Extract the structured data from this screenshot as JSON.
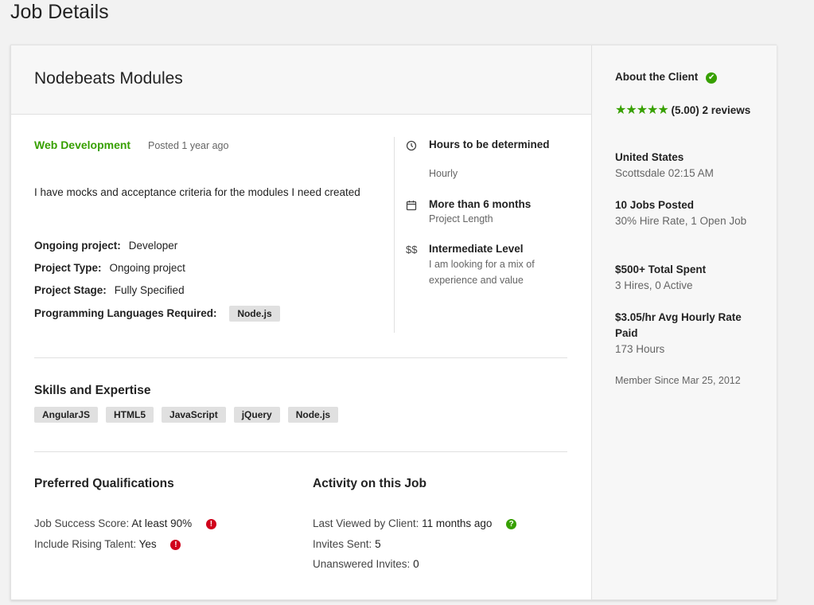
{
  "page": {
    "title": "Job Details"
  },
  "job": {
    "title": "Nodebeats Modules",
    "category": "Web Development",
    "posted": "Posted 1 year ago",
    "description": "I have mocks and acceptance criteria for the modules I need created",
    "details": [
      {
        "label": "Ongoing project:",
        "value": "Developer"
      },
      {
        "label": "Project Type:",
        "value": "Ongoing project"
      },
      {
        "label": "Project Stage:",
        "value": "Fully Specified"
      }
    ],
    "languages_label": "Programming Languages Required:",
    "languages": [
      "Node.js"
    ]
  },
  "summary": [
    {
      "icon": "clock-icon",
      "title": "Hours to be determined",
      "sub": "Hourly"
    },
    {
      "icon": "calendar-icon",
      "title": "More than 6 months",
      "sub": "Project Length"
    },
    {
      "icon": "dollar-icon",
      "symbol": "$$",
      "title": "Intermediate Level",
      "sub": "I am looking for a mix of experience and value"
    }
  ],
  "skills": {
    "heading": "Skills and Expertise",
    "tags": [
      "AngularJS",
      "HTML5",
      "JavaScript",
      "jQuery",
      "Node.js"
    ]
  },
  "qualifications": {
    "heading": "Preferred Qualifications",
    "items": [
      {
        "label": "Job Success Score:",
        "value": "At least 90%"
      },
      {
        "label": "Include Rising Talent:",
        "value": "Yes"
      }
    ]
  },
  "activity": {
    "heading": "Activity on this Job",
    "items": [
      {
        "label": "Last Viewed by Client:",
        "value": "11 months ago"
      },
      {
        "label": "Invites Sent:",
        "value": "5"
      },
      {
        "label": "Unanswered Invites:",
        "value": "0"
      }
    ]
  },
  "client": {
    "heading": "About the Client",
    "rating_text": "(5.00) 2 reviews",
    "rating_value": 5,
    "rating_max": 5,
    "country": "United States",
    "local_time": "Scottsdale 02:15 AM",
    "jobs_posted": "10 Jobs Posted",
    "hire_rate": "30% Hire Rate, 1 Open Job",
    "total_spent": "$500+ Total Spent",
    "hires": "3 Hires, 0 Active",
    "avg_rate": "$3.05/hr Avg Hourly Rate Paid",
    "hours": "173 Hours",
    "member_since": "Member Since Mar 25, 2012"
  },
  "colors": {
    "accent": "#37a000",
    "alert": "#d0021b"
  }
}
